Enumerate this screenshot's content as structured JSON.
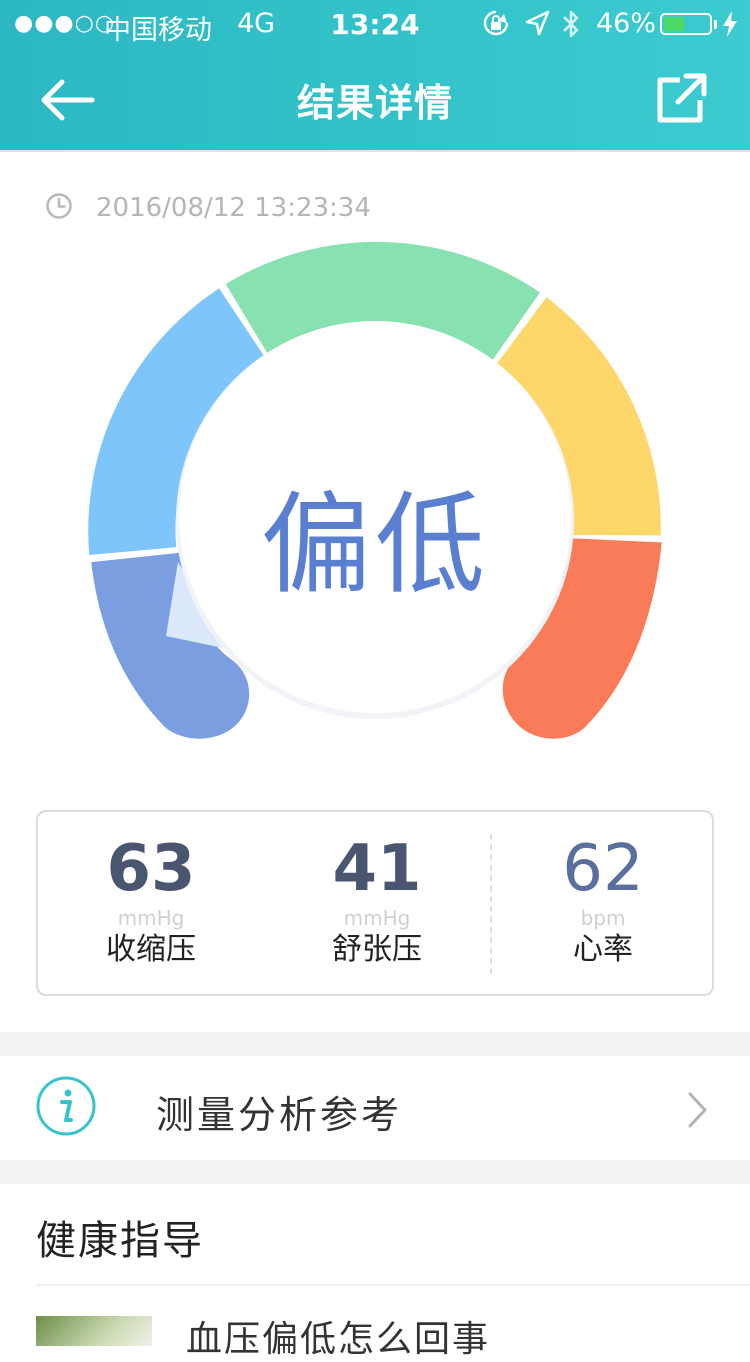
{
  "status_bar": {
    "signal": "●●●○○",
    "carrier": "中国移动",
    "network": "4G",
    "time": "13:24",
    "battery_percent": "46%",
    "battery_level": 0.46,
    "icons": [
      "rotation-lock-icon",
      "location-arrow-icon",
      "bluetooth-icon",
      "battery-icon",
      "charging-bolt-icon"
    ]
  },
  "nav": {
    "title": "结果详情",
    "back_icon": "back-arrow-icon",
    "share_icon": "share-icon"
  },
  "timestamp": "2016/08/12 13:23:34",
  "gauge": {
    "result": "偏低",
    "colors": {
      "low": "#7a9ee0",
      "blue": "#7ec5fb",
      "green": "#88e1b0",
      "yellow": "#fed76a",
      "orange": "#fa7b57",
      "label": "#5b7fd0"
    }
  },
  "stats": [
    {
      "value": "63",
      "unit": "mmHg",
      "label": "收缩压"
    },
    {
      "value": "41",
      "unit": "mmHg",
      "label": "舒张压"
    },
    {
      "value": "62",
      "unit": "bpm",
      "label": "心率"
    }
  ],
  "analysis": {
    "label": "测量分析参考",
    "icon": "info-icon"
  },
  "guide": {
    "title": "健康指导",
    "article_title": "血压偏低怎么回事"
  }
}
